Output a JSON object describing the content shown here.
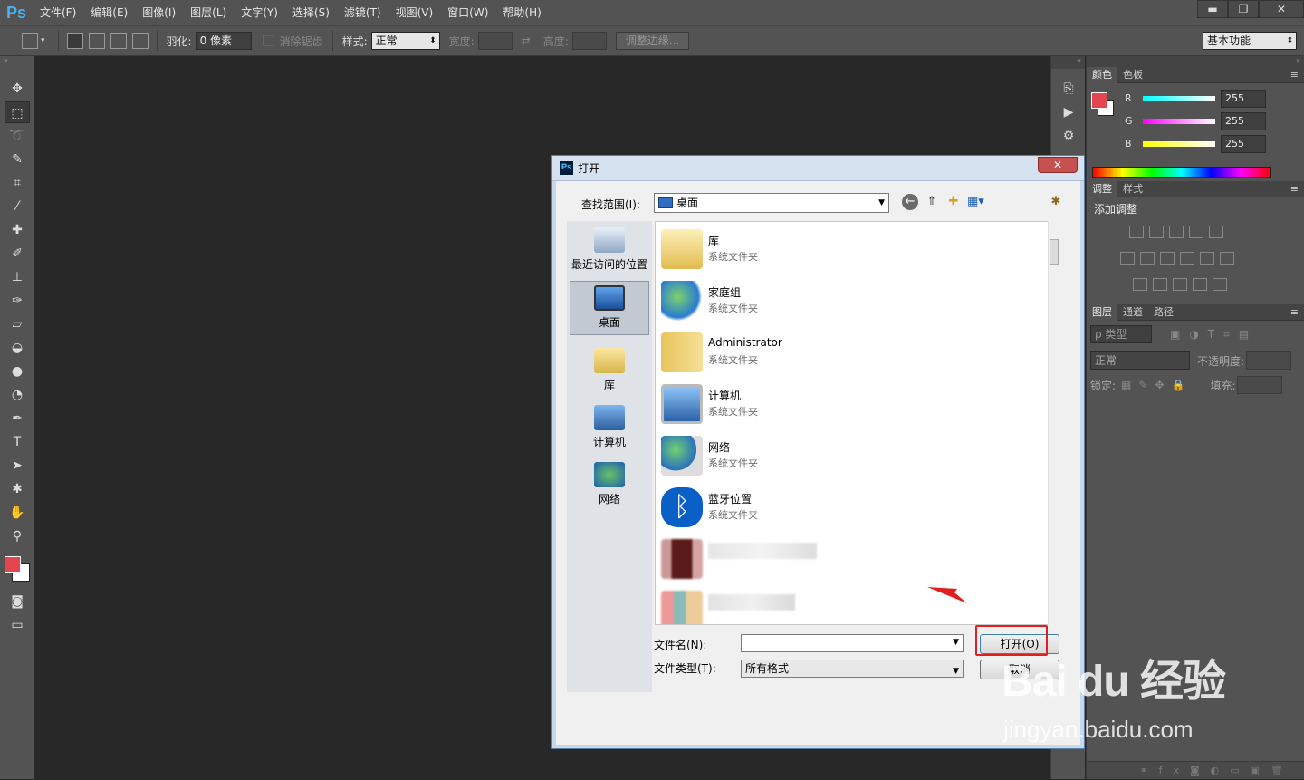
{
  "app": {
    "logo": "Ps"
  },
  "menu": [
    "文件(F)",
    "编辑(E)",
    "图像(I)",
    "图层(L)",
    "文字(Y)",
    "选择(S)",
    "滤镜(T)",
    "视图(V)",
    "窗口(W)",
    "帮助(H)"
  ],
  "window_controls": {
    "minimize": "▬",
    "restore": "❐",
    "close": "✕"
  },
  "options": {
    "feather_label": "羽化:",
    "feather_value": "0 像素",
    "antialias_label": "消除锯齿",
    "style_label": "样式:",
    "style_value": "正常",
    "width_label": "宽度:",
    "height_label": "高度:",
    "refine_edge": "调整边缘...",
    "workspace": "基本功能"
  },
  "color_panel": {
    "tabs": [
      "颜色",
      "色板"
    ],
    "r_label": "R",
    "r_value": "255",
    "g_label": "G",
    "g_value": "255",
    "b_label": "B",
    "b_value": "255"
  },
  "adjust_panel": {
    "tabs": [
      "调整",
      "样式"
    ],
    "title": "添加调整"
  },
  "layers_panel": {
    "tabs": [
      "图层",
      "通道",
      "路径"
    ],
    "filter_label": "ρ 类型",
    "blend_mode": "正常",
    "opacity_label": "不透明度:",
    "lock_label": "锁定:",
    "fill_label": "填充:"
  },
  "dialog": {
    "title": "打开",
    "lookin_label": "查找范围(I):",
    "lookin_value": "桌面",
    "places": [
      "最近访问的位置",
      "桌面",
      "库",
      "计算机",
      "网络"
    ],
    "files": [
      {
        "name": "库",
        "type": "系统文件夹"
      },
      {
        "name": "家庭组",
        "type": "系统文件夹"
      },
      {
        "name": "Administrator",
        "type": "系统文件夹"
      },
      {
        "name": "计算机",
        "type": "系统文件夹"
      },
      {
        "name": "网络",
        "type": "系统文件夹"
      },
      {
        "name": "蓝牙位置",
        "type": "系统文件夹"
      }
    ],
    "filename_label": "文件名(N):",
    "filename_value": "",
    "filetype_label": "文件类型(T):",
    "filetype_value": "所有格式",
    "open_button": "打开(O)",
    "cancel_button": "取消"
  },
  "watermark": {
    "brand": "Bai du 经验",
    "url": "jingyan.baidu.com"
  }
}
